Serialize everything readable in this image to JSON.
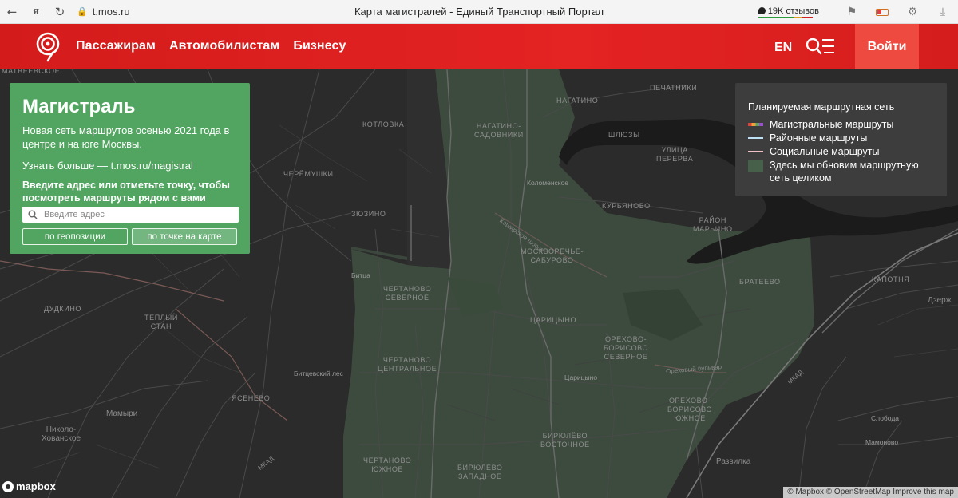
{
  "browser": {
    "url": "t.mos.ru",
    "title": "Карта магистралей - Единый Транспортный Портал",
    "reviews": "19K отзывов",
    "icons": [
      "back-icon",
      "yandex-icon",
      "reload-icon",
      "lock-icon",
      "bookmark-icon",
      "battery-icon",
      "extension-icon",
      "download-icon"
    ]
  },
  "header": {
    "nav": [
      "Пассажирам",
      "Автомобилистам",
      "Бизнесу"
    ],
    "lang": "EN",
    "login": "Войти",
    "brand_color": "#e42323"
  },
  "info": {
    "title": "Магистраль",
    "description": "Новая сеть маршрутов осенью 2021 года в центре и на юге Москвы.",
    "more": "Узнать больше — t.mos.ru/magistral",
    "prompt": "Введите адрес или отметьте точку, чтобы посмотреть маршруты рядом с вами",
    "search_placeholder": "Введите адрес",
    "btn_geo": "по геопозиции",
    "btn_point": "по точке на карте",
    "panel_color": "#52a560"
  },
  "legend": {
    "title": "Планируемая маршрутная сеть",
    "items": [
      {
        "label": "Магистральные маршруты",
        "swatch": "multi"
      },
      {
        "label": "Районные маршруты",
        "swatch": "#bde0f5"
      },
      {
        "label": "Социальные маршруты",
        "swatch": "#f2c0c8"
      },
      {
        "label": "Здесь мы обновим маршрутную сеть целиком",
        "swatch": "#46604a"
      }
    ]
  },
  "map": {
    "labels": {
      "matveevskoe": "Матвеевское",
      "kotlovka": "Котловка",
      "cheryomushki": "Черёмушки",
      "zyuzino": "Зюзино",
      "nagatino": "Нагатино",
      "nagatino_sadovniki": "Нагатино-\nСадовники",
      "shlyuzy": "Шлюзы",
      "kolomenskoe": "Коломенское",
      "kashirskoe": "Каширское шоссе",
      "pechatniki": "Печатники",
      "ulitsa_pererva": "Улица\nПерерва",
      "kuryanovo": "Курьяново",
      "rayon_marino": "Район\nМарьино",
      "moskvorechye": "Москворечье-\nСабурово",
      "bitsa": "Битца",
      "chertanovo_sev": "Чертаново\nСеверное",
      "bratevo": "Братеево",
      "kapotnya": "Капотня",
      "dzerzh": "Дзерж",
      "dudkino": "Дудкино",
      "teply_stan": "Тёплый\nСтан",
      "tsaritsyno_upper": "Царицыно",
      "orekhovo_sev": "Орехово-\nБорисово\nСеверное",
      "bitsevsky": "Битцевский лес",
      "chertanovo_tsen": "Чертаново\nЦентральное",
      "tsaritsyno_lower": "Царицыно",
      "orekhovy_bulvar": "Ореховый бульвар",
      "mkad_east": "МКАД",
      "yasenevo": "Ясенево",
      "mamyri": "Мамыри",
      "orekhovo_yuzh": "Орехово-\nБорисово\nЮжное",
      "sloboda": "Слобода",
      "nikolo": "Николо-\nХованское",
      "biryulevo_vost": "Бирюлёво\nВосточное",
      "mamonovo": "Мамоново",
      "razvilka": "Развилка",
      "mkad_south": "МКАД",
      "chertanovo_yuzh": "Чертаново\nЮжное",
      "biryulevo_zap": "Бирюлёво\nЗападное"
    },
    "mapbox": "mapbox",
    "attribution": "© Mapbox © OpenStreetMap Improve this map"
  }
}
